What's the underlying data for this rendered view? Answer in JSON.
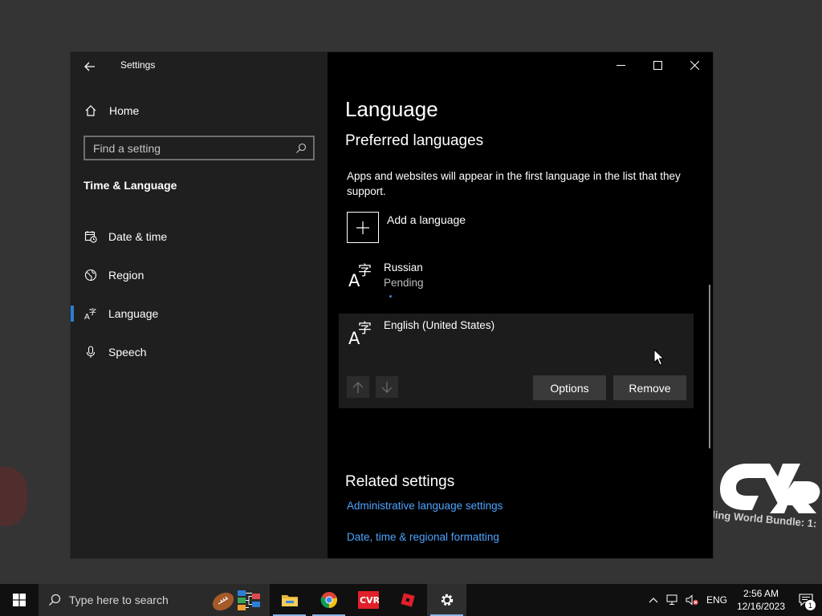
{
  "window": {
    "app_title": "Settings",
    "controls": [
      "minimize-icon",
      "maximize-icon",
      "close-icon"
    ]
  },
  "nav": {
    "home_label": "Home",
    "search_placeholder": "Find a setting",
    "section_title": "Time & Language",
    "items": [
      {
        "label": "Date & time",
        "icon": "calendar-clock-icon"
      },
      {
        "label": "Region",
        "icon": "globe-icon"
      },
      {
        "label": "Language",
        "icon": "language-icon",
        "selected": true
      },
      {
        "label": "Speech",
        "icon": "microphone-icon"
      }
    ]
  },
  "content": {
    "page_title": "Language",
    "sub_title": "Preferred languages",
    "description": "Apps and websites will appear in the first language in the list that they support.",
    "add_language_label": "Add a language",
    "languages": [
      {
        "name": "Russian",
        "status": "Pending"
      },
      {
        "name": "English (United States)",
        "status": "",
        "selected": true
      }
    ],
    "buttons": {
      "options": "Options",
      "remove": "Remove"
    },
    "related_title": "Related settings",
    "links": [
      "Administrative language settings",
      "Date, time & regional formatting"
    ]
  },
  "desktop": {
    "logo_caption": "ling World Bundle: 1:"
  },
  "taskbar": {
    "search_placeholder": "Type here to search",
    "apps": [
      "file-explorer-icon",
      "chrome-icon",
      "cvr-icon",
      "roblox-icon",
      "settings-gear-icon"
    ],
    "tray_language": "ENG",
    "time": "2:56 AM",
    "date": "12/16/2023",
    "notification_count": "1"
  },
  "colors": {
    "accent": "#2b7fd7",
    "link": "#4ea3ff",
    "nav_bg": "#1f1f1f",
    "content_bg": "#000000"
  }
}
